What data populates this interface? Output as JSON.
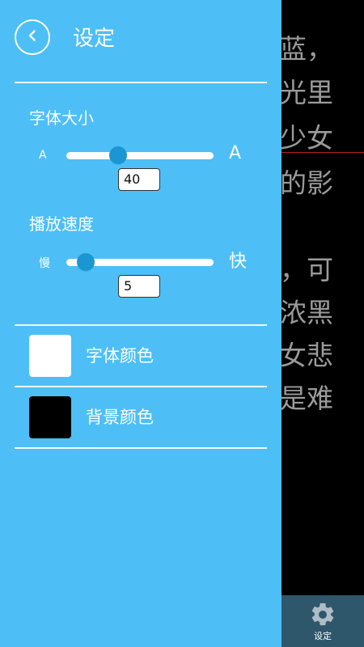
{
  "reader": {
    "lines": [
      "蓝，",
      "光里",
      "少女",
      "的影",
      "",
      "，可",
      "浓黑",
      "女悲",
      "是难"
    ]
  },
  "settings": {
    "title": "设定",
    "back_icon": "chevron-left-icon",
    "font_size": {
      "label": "字体大小",
      "min_label": "A",
      "max_label": "A",
      "value": "40",
      "level": 0.35
    },
    "play_speed": {
      "label": "播放速度",
      "min_label": "慢",
      "max_label": "快",
      "value": "5",
      "level": 0.13
    },
    "font_color": {
      "label": "字体颜色",
      "swatch": "#FFFFFF"
    },
    "background_color": {
      "label": "背景颜色",
      "swatch": "#000000"
    }
  },
  "tabbar": {
    "settings_label": "设定",
    "settings_icon": "gear-icon"
  },
  "colors": {
    "panel_bg": "#4DBFF6",
    "reader_bg": "#000000",
    "reader_text": "#9A9A9A",
    "tab_bg": "#2E576B",
    "accent": "#1A96D2"
  }
}
